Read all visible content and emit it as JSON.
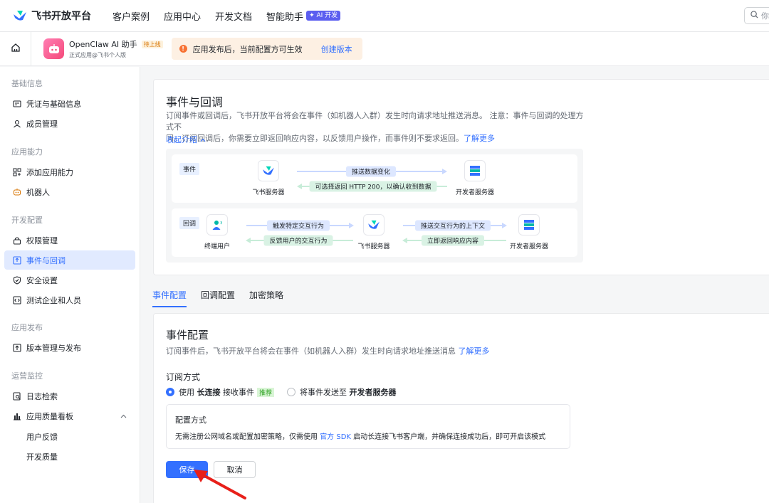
{
  "topnav": {
    "logo_text": "飞书开放平台",
    "items": [
      "客户案例",
      "应用中心",
      "开发文档",
      "智能助手"
    ],
    "ai_badge": "AI 开发",
    "search_placeholder": "你"
  },
  "appbar": {
    "app_name": "OpenClaw AI 助手",
    "app_status": "待上线",
    "app_sub": "正式应用@飞书个人版",
    "notice_text": "应用发布后，当前配置方可生效",
    "notice_link": "创建版本"
  },
  "sidebar": {
    "groups": [
      "基础信息",
      "应用能力",
      "开发配置",
      "应用发布",
      "运营监控"
    ],
    "items": [
      "凭证与基础信息",
      "成员管理",
      "添加应用能力",
      "机器人",
      "权限管理",
      "事件与回调",
      "安全设置",
      "测试企业和人员",
      "版本管理与发布",
      "日志检索",
      "应用质量看板"
    ],
    "subs": [
      "用户反馈",
      "开发质量"
    ]
  },
  "intro": {
    "title": "事件与回调",
    "desc1": "订阅事件或回调后，飞书开放平台将会在事件（如机器人入群）发生时向请求地址推送消息。 注意：事件与回调的处理方式不",
    "desc2": "同。订阅回调后，你需要立即返回响应内容，以反馈用户操作，而事件则不要求返回。",
    "learn_more": "了解更多",
    "collapse": "收起介绍"
  },
  "diagram": {
    "event_tag": "事件",
    "callback_tag": "回调",
    "feishu_server": "飞书服务器",
    "dev_server": "开发者服务器",
    "end_user": "终端用户",
    "push_data": "推送数据变化",
    "return_http": "可选择返回 HTTP 200，以确认收到数据",
    "trigger": "触发特定交互行为",
    "feedback": "反馈用户的交互行为",
    "push_context": "推送交互行为的上下文",
    "return_now": "立即返回响应内容"
  },
  "tabs": [
    "事件配置",
    "回调配置",
    "加密策略"
  ],
  "event_config": {
    "title": "事件配置",
    "desc": "订阅事件后，飞书开放平台将会在事件（如机器人入群）发生时向请求地址推送消息",
    "learn_more": "了解更多",
    "sub_label": "订阅方式",
    "opt1_pre": "使用",
    "opt1_bold": "长连接",
    "opt1_post": "接收事件",
    "opt1_badge": "推荐",
    "opt2_pre": "将事件发送至",
    "opt2_bold": "开发者服务器",
    "box_title": "配置方式",
    "box_desc_pre": "无需注册公网域名或配置加密策略，仅需使用",
    "box_desc_link": "官方 SDK",
    "box_desc_post": "启动长连接飞书客户端，并确保连接成功后，即可开启该模式",
    "save": "保存",
    "cancel": "取消"
  },
  "colors": {
    "accent": "#3370ff",
    "arrow": "#e8201a"
  }
}
